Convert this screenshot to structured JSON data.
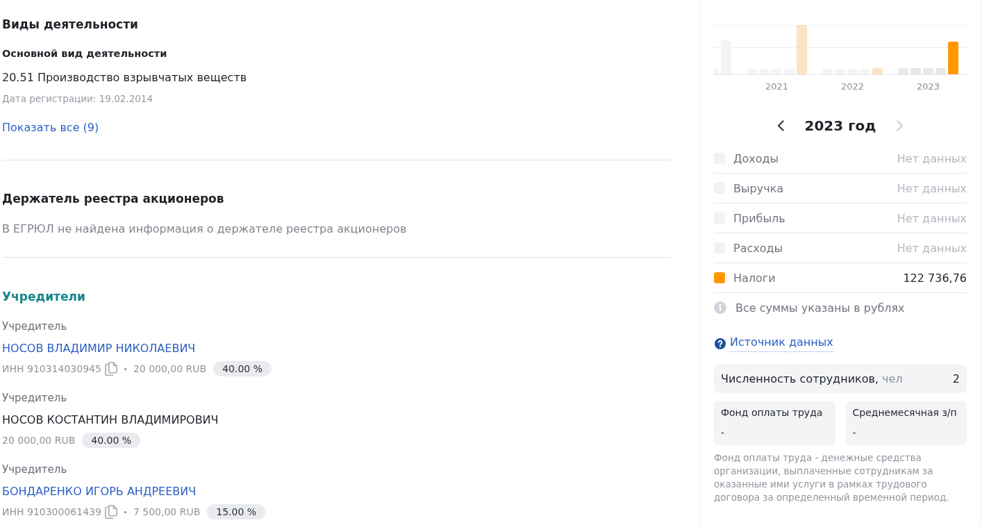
{
  "activities": {
    "title": "Виды деятельности",
    "main_title": "Основной вид деятельности",
    "main_activity": "20.51 Производство взрывчатых веществ",
    "registration_date": "Дата регистрации: 19.02.2014",
    "show_all_link": "Показать все (9)"
  },
  "registry_holder": {
    "title": "Держатель реестра акционеров",
    "message": "В ЕГРЮЛ не найдена информация о держателе реестра акционеров"
  },
  "founders": {
    "title": "Учредители",
    "items": [
      {
        "role": "Учредитель",
        "name": "НОСОВ ВЛАДИМИР НИКОЛАЕВИЧ",
        "linked": true,
        "inn": "ИНН 910314030945",
        "amount": "20 000,00 RUB",
        "share": "40.00 %"
      },
      {
        "role": "Учредитель",
        "name": "НОСОВ КОСТАНТИН ВЛАДИМИРОВИЧ",
        "linked": false,
        "amount": "20 000,00 RUB",
        "share": "40.00 %"
      },
      {
        "role": "Учредитель",
        "name": "БОНДАРЕНКО ИГОРЬ АНДРЕЕВИЧ",
        "linked": true,
        "inn": "ИНН 910300061439",
        "amount": "7 500,00 RUB",
        "share": "15.00 %"
      }
    ]
  },
  "finance": {
    "chart": {
      "year_labels": [
        "2021",
        "2022",
        "2023"
      ]
    },
    "year_nav": {
      "title": "2023 год",
      "prev_disabled": false,
      "next_disabled": true
    },
    "indicators": [
      {
        "label": "Доходы",
        "value": "Нет данных",
        "color": "#f0f2f5",
        "no_data": true
      },
      {
        "label": "Выручка",
        "value": "Нет данных",
        "color": "#f0f2f5",
        "no_data": true
      },
      {
        "label": "Прибыль",
        "value": "Нет данных",
        "color": "#f0f2f5",
        "no_data": true
      },
      {
        "label": "Расходы",
        "value": "Нет данных",
        "color": "#f0f2f5",
        "no_data": true
      },
      {
        "label": "Налоги",
        "value": "122 736,76",
        "color": "#ff9800",
        "no_data": false
      }
    ],
    "note": "Все суммы указаны в рублях",
    "source_link": "Источник данных",
    "employees": {
      "label": "Численность сотрудников,",
      "unit": "чел",
      "value": "2"
    },
    "payroll": [
      {
        "label": "Фонд оплаты труда",
        "value": "-"
      },
      {
        "label": "Среднемесячная з/п",
        "value": "-"
      }
    ],
    "footnote": "Фонд оплаты труда - денежные средства организации, выплаченные сотрудникам за оказанные ими услуги в рамках трудового договора за определенный временной период."
  }
}
